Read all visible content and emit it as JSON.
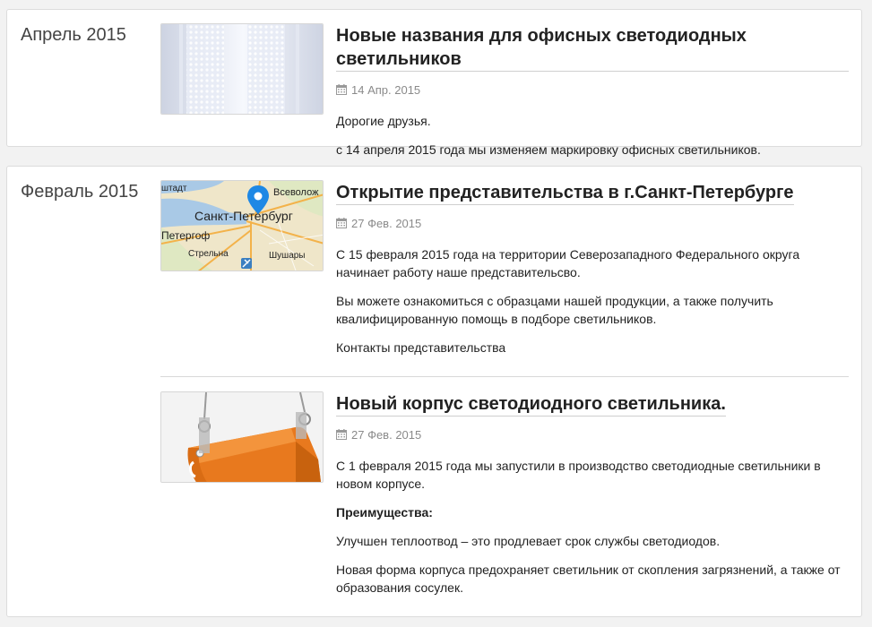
{
  "sections": [
    {
      "month": "Апрель 2015",
      "posts": [
        {
          "title": "Новые названия для офисных светодиодных светильников",
          "date": "14 Апр. 2015",
          "paragraphs": [
            "Дорогие друзья.",
            "с 14 апреля 2015 года мы изменяем маркировку офисных светильников."
          ]
        }
      ]
    },
    {
      "month": "Февраль 2015",
      "posts": [
        {
          "title": "Открытие представительства в г.Санкт-Петербурге",
          "date": "27 Фев. 2015",
          "map_labels": {
            "city": "Санкт-Петербург",
            "vsevolozhsk": "Всеволож",
            "kronstadt": "штадт",
            "peterhof": "Петергоф",
            "strelna": "Стрельна",
            "shushary": "Шушары"
          },
          "paragraphs": [
            "С 15 февраля 2015 года на территории Северозападного Федерального округа начинает работу наше представительсво.",
            "Вы можете ознакомиться с образцами нашей продукции, а также получить квалифицированную помощь в подборе светильников.",
            "Контакты представительства"
          ]
        },
        {
          "title": "Новый корпус светодиодного светильника.",
          "date": "27 Фев. 2015",
          "paragraphs": [
            "С 1 февраля 2015 года мы запустили в производство светодиодные светильники в новом корпусе.",
            "Преимущества:",
            "Улучшен теплоотвод – это продлевает срок службы светодиодов.",
            "Новая форма корпуса предохраняет светильник от скопления загрязнений, а также от образования сосулек."
          ]
        }
      ]
    }
  ],
  "icons": {
    "date": "calendar-icon",
    "map_pin": "map-pin-icon",
    "airport": "airport-icon"
  },
  "colors": {
    "map_pin": "#1e88e5",
    "housing": "#e87a1e",
    "title_underline": "#cfcfcf"
  }
}
